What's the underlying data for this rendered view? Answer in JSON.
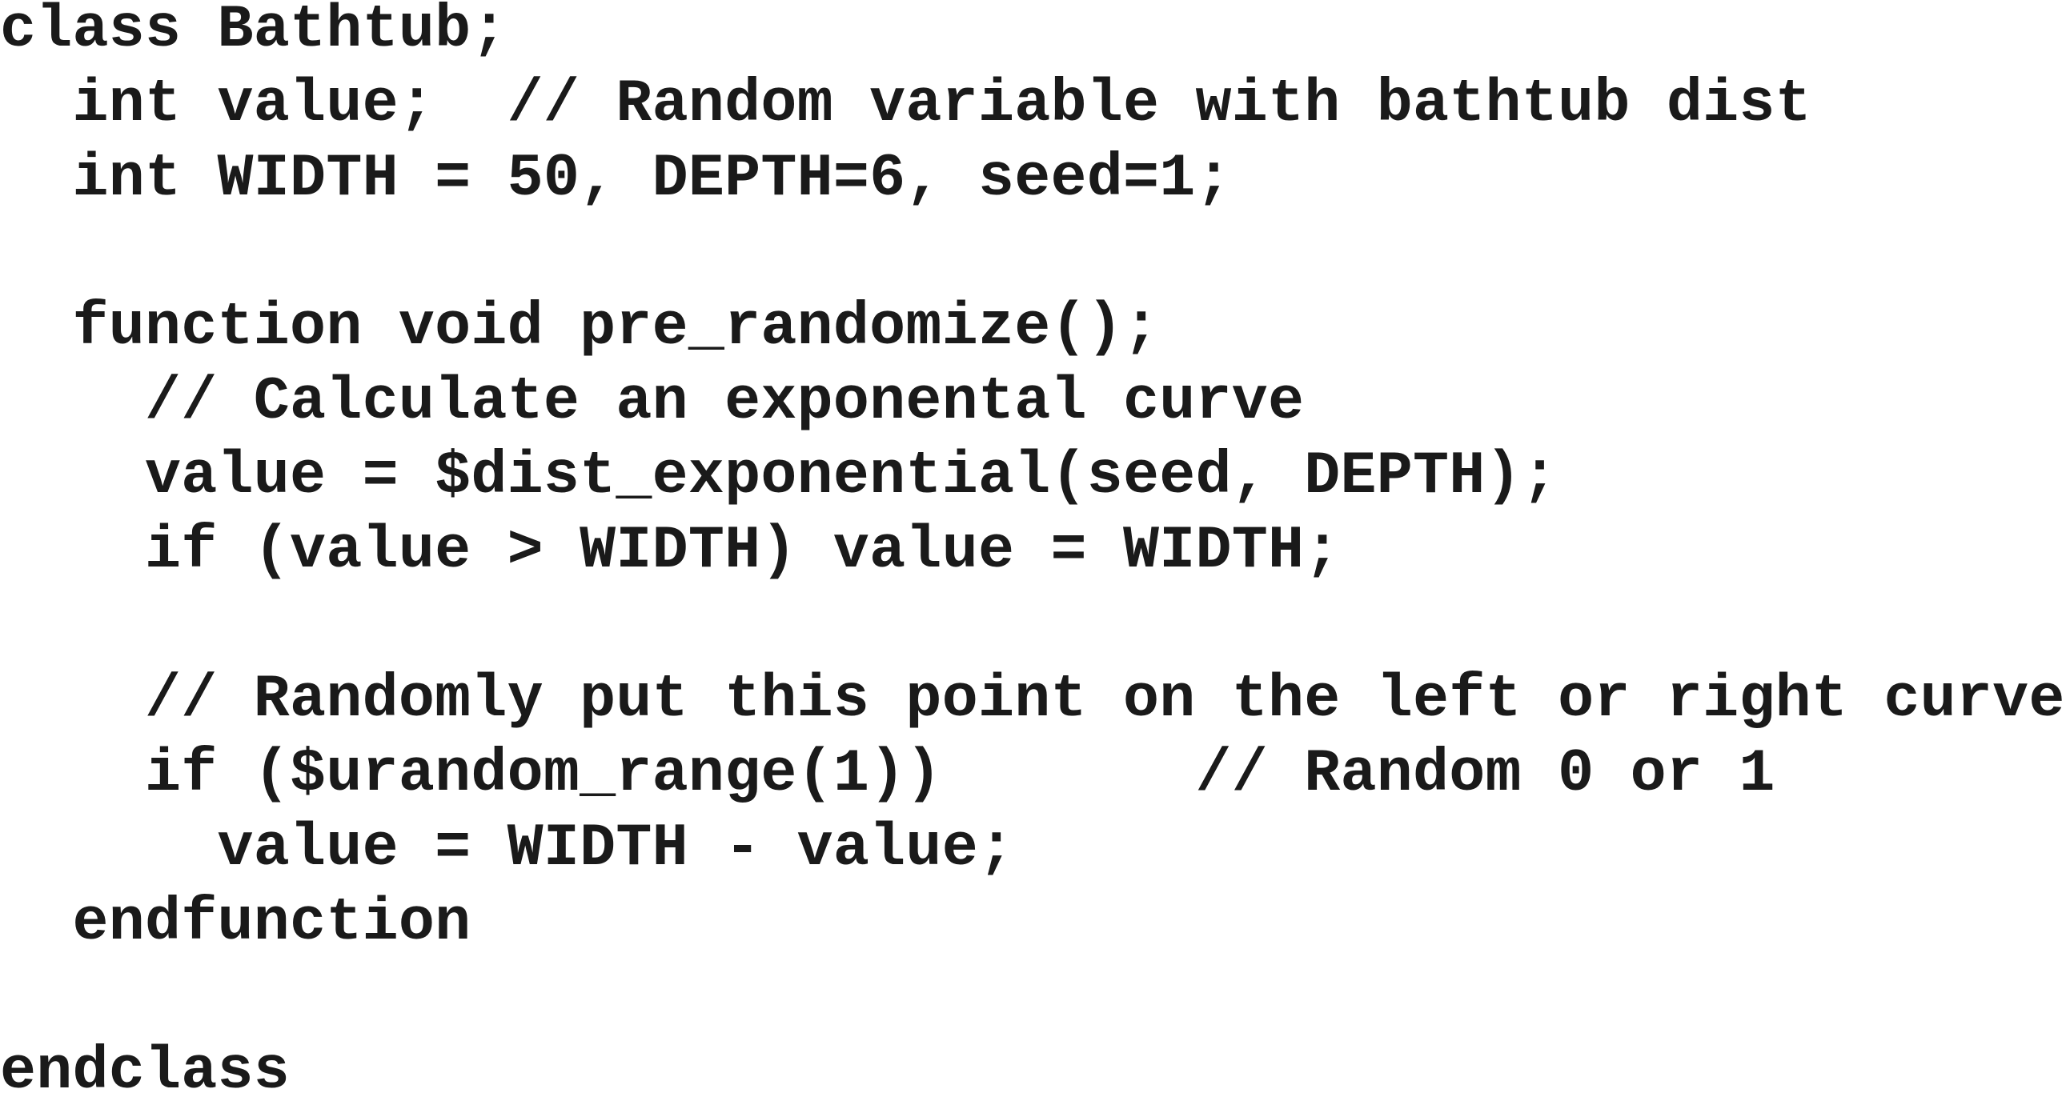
{
  "code": {
    "lines": [
      "class Bathtub;",
      "  int value;  // Random variable with bathtub dist",
      "  int WIDTH = 50, DEPTH=6, seed=1;",
      "",
      "  function void pre_randomize();",
      "    // Calculate an exponental curve",
      "    value = $dist_exponential(seed, DEPTH);",
      "    if (value > WIDTH) value = WIDTH;",
      "",
      "    // Randomly put this point on the left or right curve",
      "    if ($urandom_range(1))       // Random 0 or 1",
      "      value = WIDTH - value;",
      "  endfunction",
      "",
      "endclass"
    ]
  }
}
